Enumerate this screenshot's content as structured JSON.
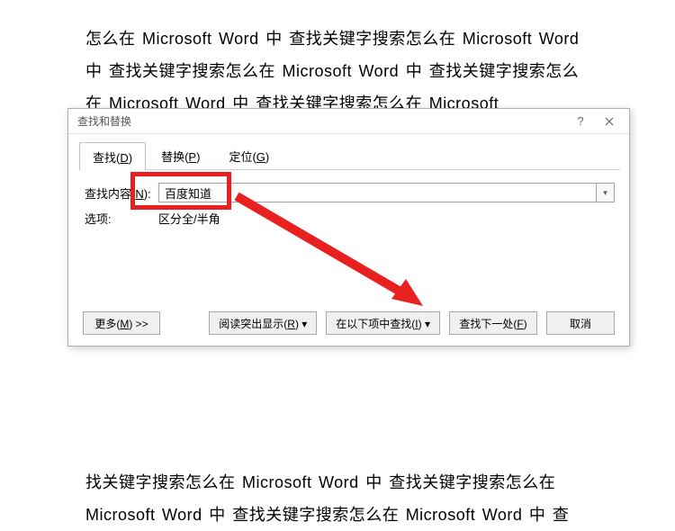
{
  "document": {
    "text_top": "怎么在  Microsoft Word  中  查找关键字搜索怎么在  Microsoft Word  中  查找关键字搜索怎么在  Microsoft Word  中  查找关键字搜索怎么在  Microsoft Word 中  查找关键字搜索怎么在  Microsoft",
    "text_bottom": "找关键字搜索怎么在  Microsoft Word  中  查找关键字搜索怎么在 Microsoft Word 中  查找关键字搜索怎么在  Microsoft Word  中  查"
  },
  "dialog": {
    "title": "查找和替换",
    "help_icon": "?",
    "tabs": {
      "find": "查找(D)",
      "replace": "替换(P)",
      "goto": "定位(G)"
    },
    "find_label": "查找内容(N):",
    "find_value": "百度知道",
    "options_label": "选项:",
    "options_value": "区分全/半角",
    "buttons": {
      "more": "更多(M) >>",
      "reading_highlight": "阅读突出显示(R)",
      "find_in": "在以下项中查找(I)",
      "find_next": "查找下一处(F)",
      "cancel": "取消"
    }
  }
}
